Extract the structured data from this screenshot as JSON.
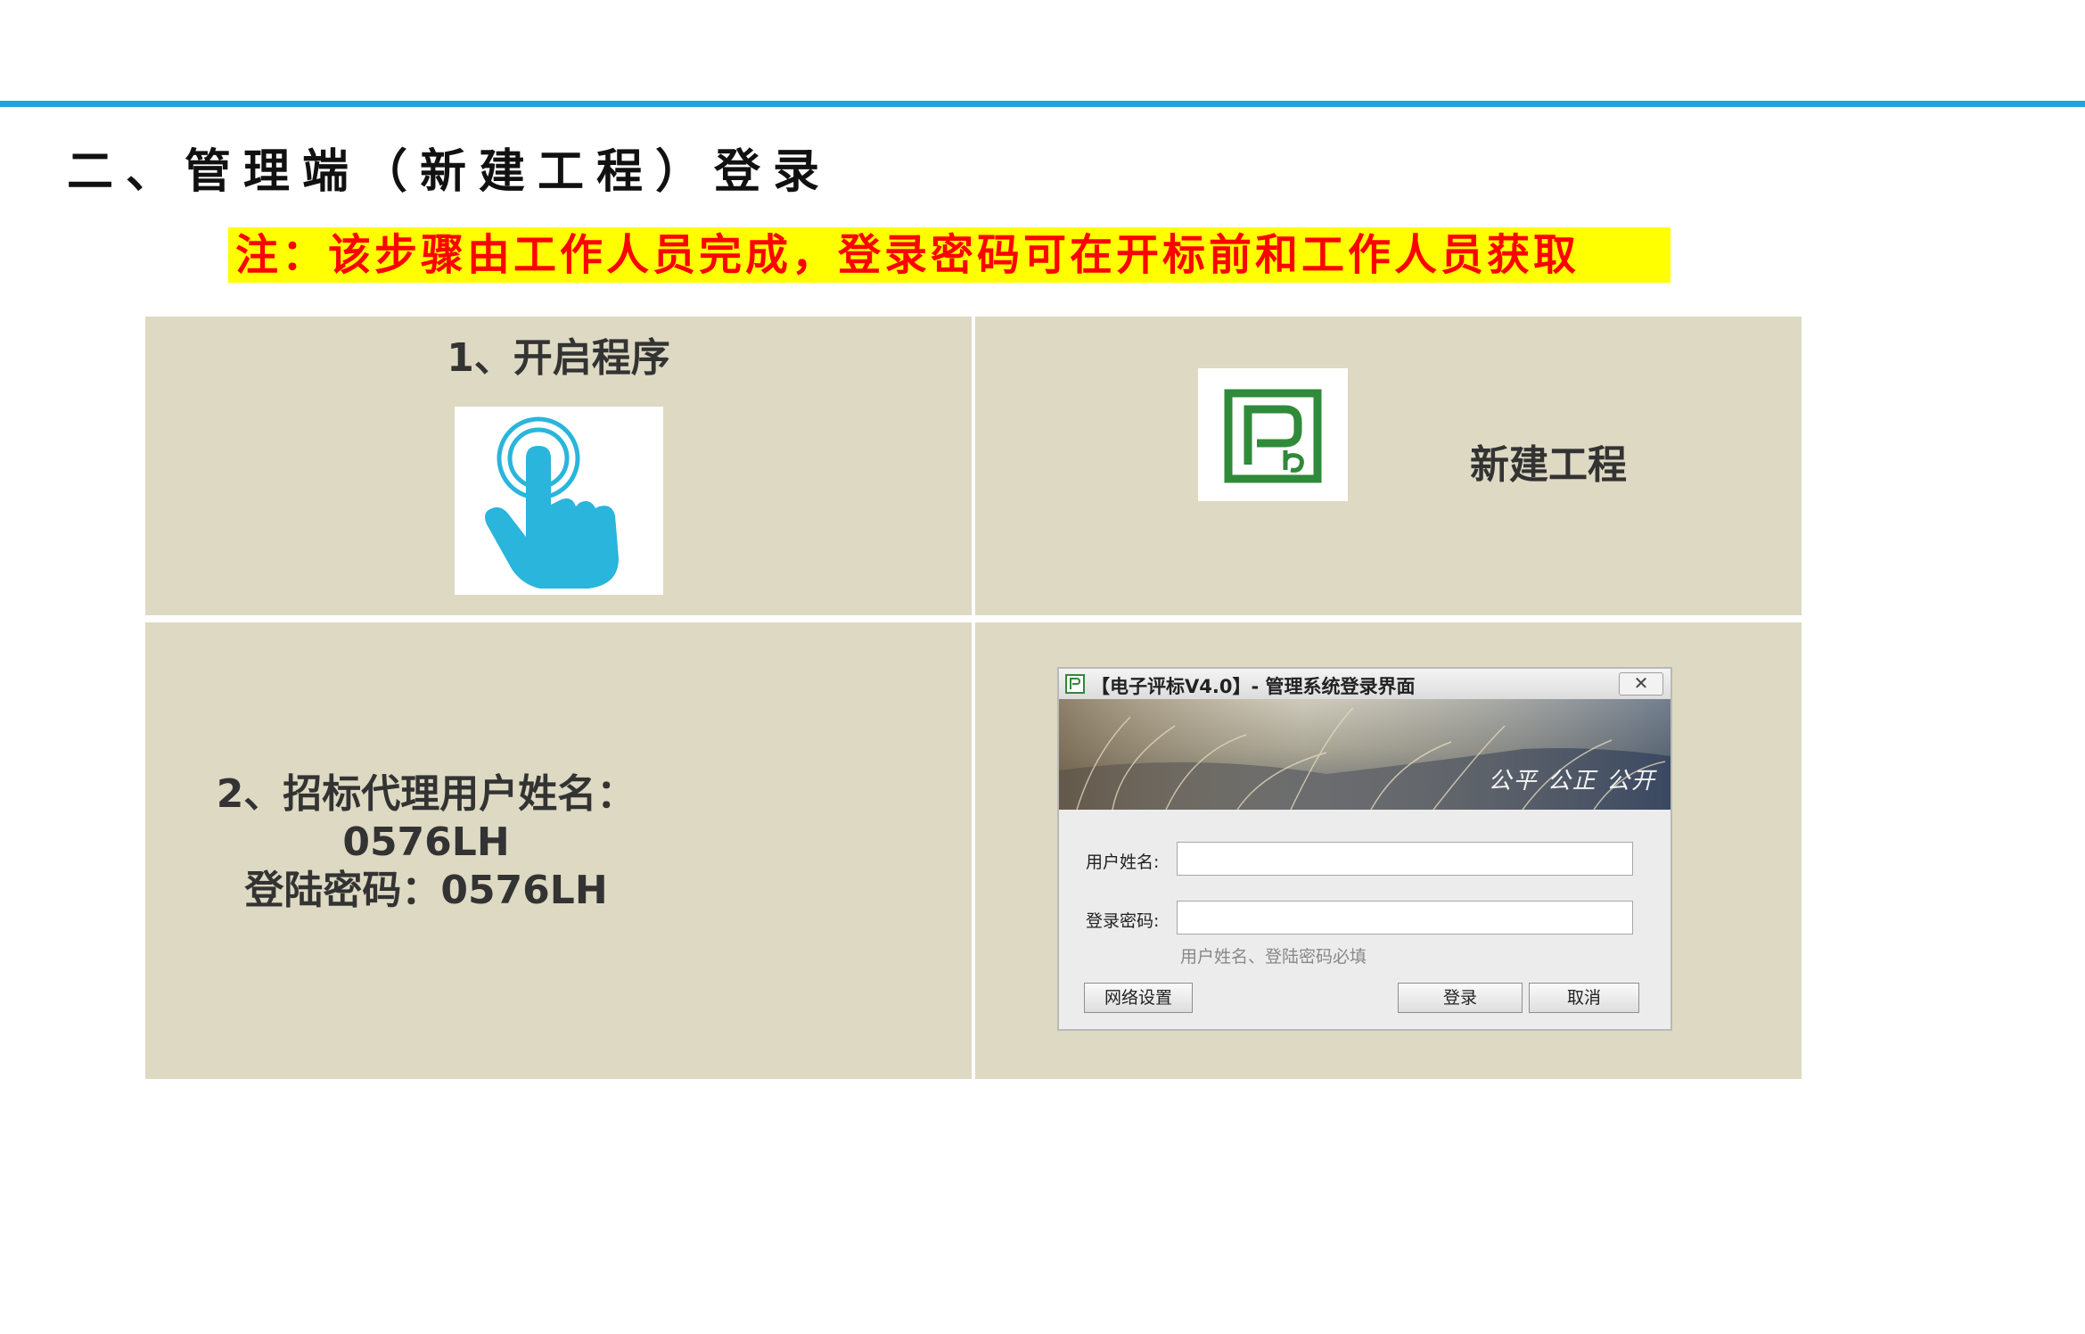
{
  "heading": "二、管理端（新建工程）登录",
  "note": "注：该步骤由工作人员完成，登录密码可在开标前和工作人员获取",
  "step1_label": "1、开启程序",
  "new_project_label": "新建工程",
  "credentials": {
    "line1": "2、招标代理用户姓名：0576LH",
    "line2": "登陆密码：0576LH"
  },
  "dialog": {
    "title": "【电子评标V4.0】- 管理系统登录界面",
    "close": "✕",
    "banner_text": "公平 公正 公开",
    "username_label": "用户姓名:",
    "password_label": "登录密码:",
    "hint": "用户姓名、登陆密码必填",
    "network_button": "网络设置",
    "login_button": "登录",
    "cancel_button": "取消"
  },
  "colors": {
    "accent_line": "#1ea5dc",
    "cell_bg": "#ddd9c3",
    "note_bg": "#ffff00",
    "note_text": "#ff0000",
    "hand_icon": "#29b5dc",
    "logo_green": "#2f8a3a"
  }
}
